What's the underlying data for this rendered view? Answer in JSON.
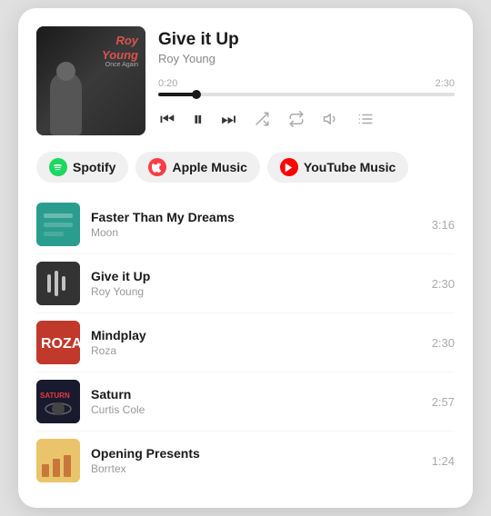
{
  "card": {
    "nowPlaying": {
      "title": "Give it Up",
      "artist": "Roy Young",
      "albumArtTitle": "Roy",
      "albumArtSubtitle": "Young",
      "albumArtExtra": "Once Again",
      "currentTime": "0:20",
      "totalTime": "2:30",
      "progressPercent": 13
    },
    "controls": {
      "skipBack": "⏮",
      "pause": "⏸",
      "skipForward": "⏭",
      "shuffle": "shuffle",
      "repeat": "repeat",
      "volume": "volume",
      "queue": "queue"
    },
    "serviceTabs": [
      {
        "id": "spotify",
        "label": "Spotify",
        "iconType": "spotify",
        "active": false
      },
      {
        "id": "apple",
        "label": "Apple Music",
        "iconType": "apple",
        "active": false
      },
      {
        "id": "youtube",
        "label": "YouTube Music",
        "iconType": "youtube",
        "active": false
      }
    ],
    "tracks": [
      {
        "id": 1,
        "name": "Faster Than My Dreams",
        "artist": "Moon",
        "duration": "3:16",
        "thumbClass": "thumb-moon"
      },
      {
        "id": 2,
        "name": "Give it Up",
        "artist": "Roy Young",
        "duration": "2:30",
        "thumbClass": "thumb-royyoung"
      },
      {
        "id": 3,
        "name": "Mindplay",
        "artist": "Roza",
        "duration": "2:30",
        "thumbClass": "thumb-roza"
      },
      {
        "id": 4,
        "name": "Saturn",
        "artist": "Curtis Cole",
        "duration": "2:57",
        "thumbClass": "thumb-saturn"
      },
      {
        "id": 5,
        "name": "Opening Presents",
        "artist": "Borrtex",
        "duration": "1:24",
        "thumbClass": "thumb-borrtex"
      }
    ]
  }
}
